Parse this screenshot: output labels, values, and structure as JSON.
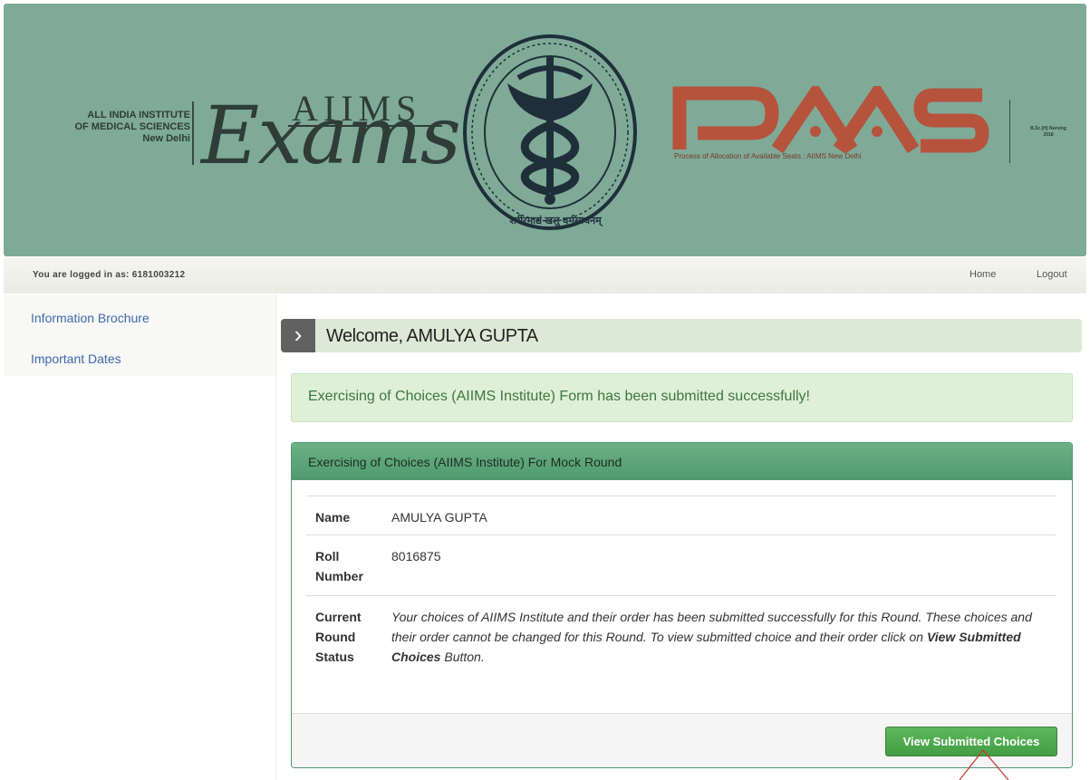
{
  "header": {
    "institute_lines": [
      "ALL INDIA INSTITUTE",
      "OF MEDICAL SCIENCES",
      "New Delhi"
    ],
    "aiims_word": "AIIMS",
    "exams_word": "Exams",
    "emblem_motto": "शरीरमाद्यं खलु धर्मसाधनम्",
    "paas_word": "PAAS",
    "paas_tagline": "Process of Allocation of Available Seats : AIIMS New Delhi",
    "side_note_lines": [
      "B.Sc.(H) Nursing",
      "2018"
    ],
    "brand_color": "#b5533c",
    "banner_color": "#7faa98"
  },
  "userbar": {
    "logged_in_text": "You are logged in as: 6181003212",
    "home_label": "Home",
    "logout_label": "Logout"
  },
  "sidebar": {
    "items": [
      {
        "label": "Information Brochure"
      },
      {
        "label": "Important Dates"
      }
    ]
  },
  "welcome": {
    "chevron_icon": "chevron-right-icon",
    "text": "Welcome, AMULYA GUPTA"
  },
  "alert": {
    "message": "Exercising of Choices (AIIMS Institute) Form has been submitted successfully!"
  },
  "panel": {
    "title": "Exercising of Choices (AIIMS Institute) For Mock Round",
    "rows": [
      {
        "label": "Name",
        "value": "AMULYA GUPTA"
      },
      {
        "label": "Roll Number",
        "value": "8016875"
      },
      {
        "label": "Current Round Status",
        "status_text_1": "Your choices of AIIMS Institute and their order has been submitted successfully for this Round. These choices and their order cannot be changed for this Round. To view submitted choice and their order click on ",
        "status_emph": "View Submitted Choices",
        "status_text_2": " Button."
      }
    ],
    "button_label": "View Submitted Choices"
  }
}
